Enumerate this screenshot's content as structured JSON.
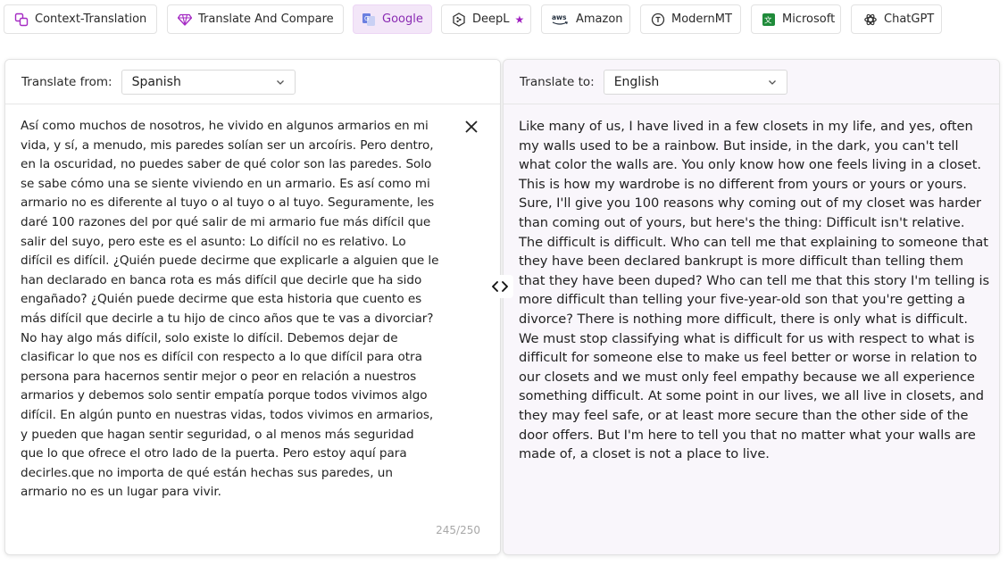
{
  "tabs": [
    {
      "label": "Context-Translation",
      "icon": "context-translation-icon",
      "active": false
    },
    {
      "label": "Translate And Compare",
      "icon": "diamond-icon",
      "active": false
    },
    {
      "label": "Google",
      "icon": "google-translate-icon",
      "active": true
    },
    {
      "label": "DeepL",
      "icon": "deepl-icon",
      "active": false,
      "badge_icon": "star-icon"
    },
    {
      "label": "Amazon",
      "icon": "aws-icon",
      "active": false
    },
    {
      "label": "ModernMT",
      "icon": "modernmt-icon",
      "active": false
    },
    {
      "label": "Microsoft",
      "icon": "microsoft-translator-icon",
      "active": false
    },
    {
      "label": "ChatGPT",
      "icon": "openai-icon",
      "active": false
    }
  ],
  "source": {
    "label": "Translate from:",
    "language": "Spanish",
    "text": "Así como muchos de nosotros, he vivido en algunos armarios en mi vida, y sí, a menudo, mis paredes solían ser un arcoíris. Pero dentro, en la oscuridad, no puedes saber de qué color son las paredes. Solo se sabe cómo una se siente viviendo en un armario. Es así como mi armario no es diferente al tuyo o al tuyo o al tuyo. Seguramente, les daré 100 razones del por qué salir de mi armario fue más difícil que salir del suyo, pero este es el asunto: Lo difícil no es relativo. Lo difícil es difícil. ¿Quién puede decirme que explicarle a alguien que le han declarado en banca rota es más difícil que decirle que ha sido engañado? ¿Quién puede decirme que esta historia que cuento es más difícil que decirle a tu hijo de cinco años que te vas a divorciar? No hay algo más difícil, solo existe lo difícil. Debemos dejar de clasificar lo que nos es difícil con respecto a lo que difícil para otra persona para hacernos sentir mejor o peor en relación a nuestros armarios y debemos solo sentir empatía porque todos vivimos algo difícil. En algún punto en nuestras vidas, todos vivimos en armarios, y pueden que hagan sentir seguridad, o al menos más seguridad que lo que ofrece el otro lado de la puerta. Pero estoy aquí para decirles.que no importa de qué están hechas sus paredes, un armario no es un lugar para vivir.",
    "counter": "245/250"
  },
  "target": {
    "label": "Translate to:",
    "language": "English",
    "text": "Like many of us, I have lived in a few closets in my life, and yes, often my walls used to be a rainbow. But inside, in the dark, you can't tell what color the walls are. You only know how one feels living in a closet. This is how my wardrobe is no different from yours or yours or yours. Sure, I'll give you 100 reasons why coming out of my closet was harder than coming out of yours, but here's the thing: Difficult isn't relative. The difficult is difficult. Who can tell me that explaining to someone that they have been declared bankrupt is more difficult than telling them that they have been duped? Who can tell me that this story I'm telling is more difficult than telling your five-year-old son that you're getting a divorce? There is nothing more difficult, there is only what is difficult. We must stop classifying what is difficult for us with respect to what is difficult for someone else to make us feel better or worse in relation to our closets and we must only feel empathy because we all experience something difficult. At some point in our lives, we all live in closets, and they may feel safe, or at least more secure than the other side of the door offers. But I'm here to tell you that no matter what your walls are made of, a closet is not a place to live."
  },
  "controls": {
    "clear_icon": "close-icon",
    "swap_icon": "swap-code-icon"
  },
  "colors": {
    "accent": "#8a2bb3",
    "active_tab_bg": "#f3e6f8",
    "output_bg": "#f9f6fb"
  }
}
